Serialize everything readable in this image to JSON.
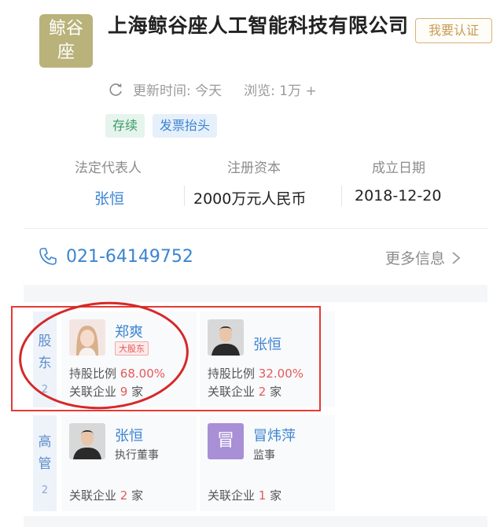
{
  "company": {
    "logo_text": "鲸谷\n座",
    "name": "上海鲸谷座人工智能科技有限公司",
    "claim_label": "我要认证",
    "update_text": "更新时间: 今天",
    "browse_text": "浏览: 1万 +",
    "tags": [
      "存续",
      "发票抬头"
    ]
  },
  "info": {
    "legal_rep_label": "法定代表人",
    "legal_rep_value": "张恒",
    "capital_label": "注册资本",
    "capital_value": "2000万元人民币",
    "date_label": "成立日期",
    "date_value": "2018-12-20"
  },
  "contact": {
    "phone": "021-64149752",
    "more_label": "更多信息"
  },
  "shareholders": {
    "label": "股\n东",
    "count": "2",
    "items": [
      {
        "name": "郑爽",
        "badge": "大股东",
        "ratio_label": "持股比例",
        "ratio_value": "68.00%",
        "assoc_label": "关联企业",
        "assoc_count": "9",
        "assoc_unit": "家"
      },
      {
        "name": "张恒",
        "ratio_label": "持股比例",
        "ratio_value": "32.00%",
        "assoc_label": "关联企业",
        "assoc_count": "2",
        "assoc_unit": "家"
      }
    ]
  },
  "executives": {
    "label": "高\n管",
    "count": "2",
    "items": [
      {
        "name": "张恒",
        "role": "执行董事",
        "assoc_label": "关联企业",
        "assoc_count": "2",
        "assoc_unit": "家"
      },
      {
        "name": "冒炜萍",
        "avatar_initial": "冒",
        "role": "监事",
        "assoc_label": "关联企业",
        "assoc_count": "1",
        "assoc_unit": "家"
      }
    ]
  }
}
